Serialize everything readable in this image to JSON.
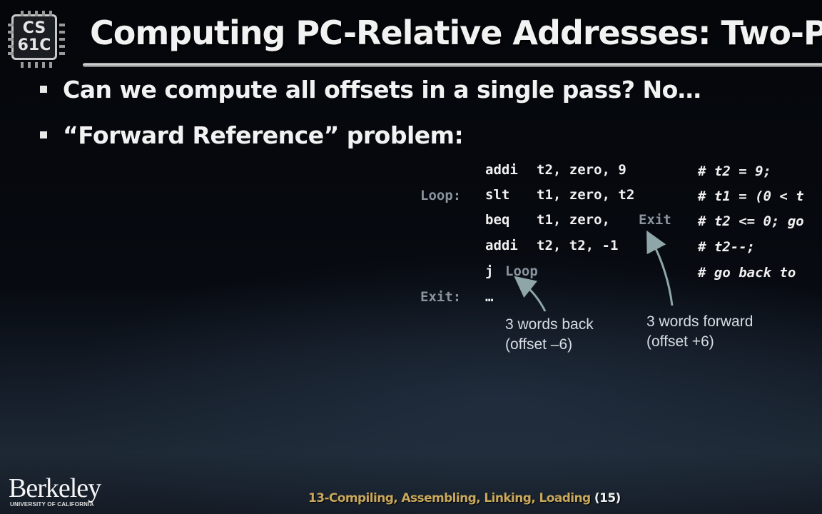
{
  "logo": {
    "line1": "CS",
    "line2": "61C"
  },
  "title": "Computing PC-Relative Addresses: Two-P",
  "bullets": [
    "Can we compute all offsets in a single pass? No…",
    "“Forward Reference” problem:"
  ],
  "code": {
    "labels": {
      "loop": "Loop:",
      "exit": "Exit:"
    },
    "lines": [
      {
        "op": "addi",
        "args": "t2, zero, 9",
        "comment": "# t2 = 9;"
      },
      {
        "op": "slt ",
        "args": "t1, zero, t2",
        "comment": "# t1 = (0 < t"
      },
      {
        "op": "beq ",
        "args": "t1, zero, ",
        "ref": "Exit",
        "comment": "# t2 <= 0; go"
      },
      {
        "op": "addi",
        "args": "t2, t2, -1",
        "comment": "# t2--;"
      },
      {
        "op": "j",
        "ref": "Loop",
        "comment": "# go back to"
      },
      {
        "op": "…"
      }
    ]
  },
  "annotations": {
    "back": {
      "line1": "3 words back",
      "line2": "(offset –6)"
    },
    "forward": {
      "line1": "3 words forward",
      "line2": "(offset +6)"
    }
  },
  "colors": {
    "arrow": "#8fa6a8",
    "footer_text": "#c9a85c",
    "label": "#8a939e"
  },
  "footer": {
    "logo": "Berkeley",
    "logo_sub": "UNIVERSITY OF CALIFORNIA",
    "text": "13-Compiling, Assembling, Linking, Loading",
    "page": "(15)"
  }
}
